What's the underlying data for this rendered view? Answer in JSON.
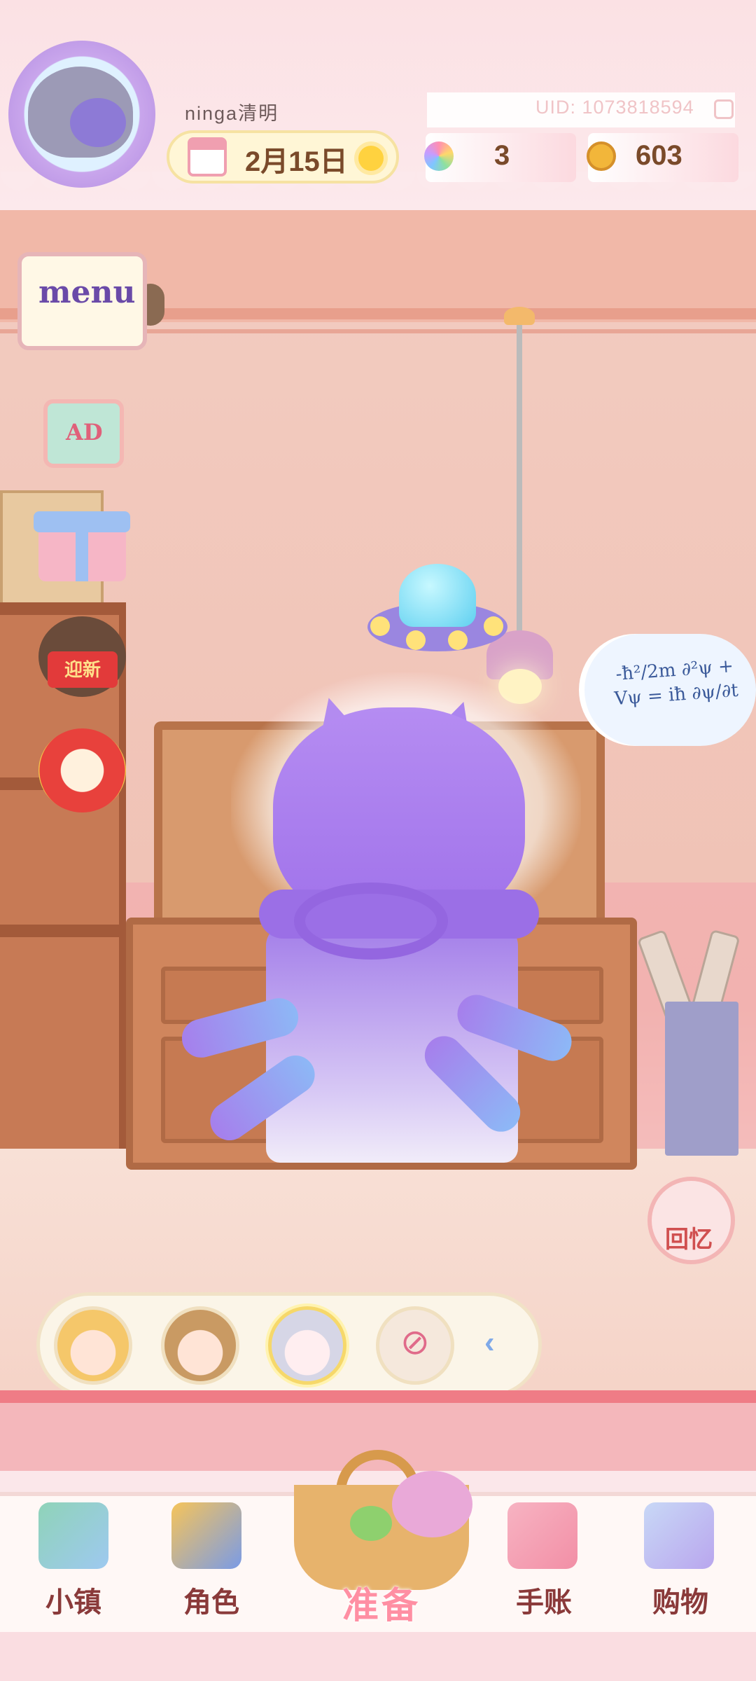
{
  "header": {
    "username": "ninga清明",
    "uid": "UID: 1073818594",
    "date": "2月15日",
    "currency_flowers": "3",
    "currency_coins": "603"
  },
  "side_buttons": {
    "menu_label": "menu",
    "ad_label": "AD",
    "event_card_text": "迎新",
    "memory_label": "回忆"
  },
  "scene": {
    "thought_bubble_text": "-ħ²/2m ∂²ψ + Vψ = iħ ∂ψ/∂t"
  },
  "character_bar": {
    "characters": [
      "blonde-girl",
      "brown-hair-boy",
      "silver-hair-girl"
    ],
    "selected_index": 2
  },
  "bottom_nav": {
    "items": [
      "小镇",
      "角色",
      "准备",
      "手账",
      "购物"
    ],
    "active": "准备"
  },
  "colors": {
    "accent_pink": "#ef7c86",
    "label_brown": "#8a3a3a",
    "octopus_purple": "#a072ea"
  }
}
